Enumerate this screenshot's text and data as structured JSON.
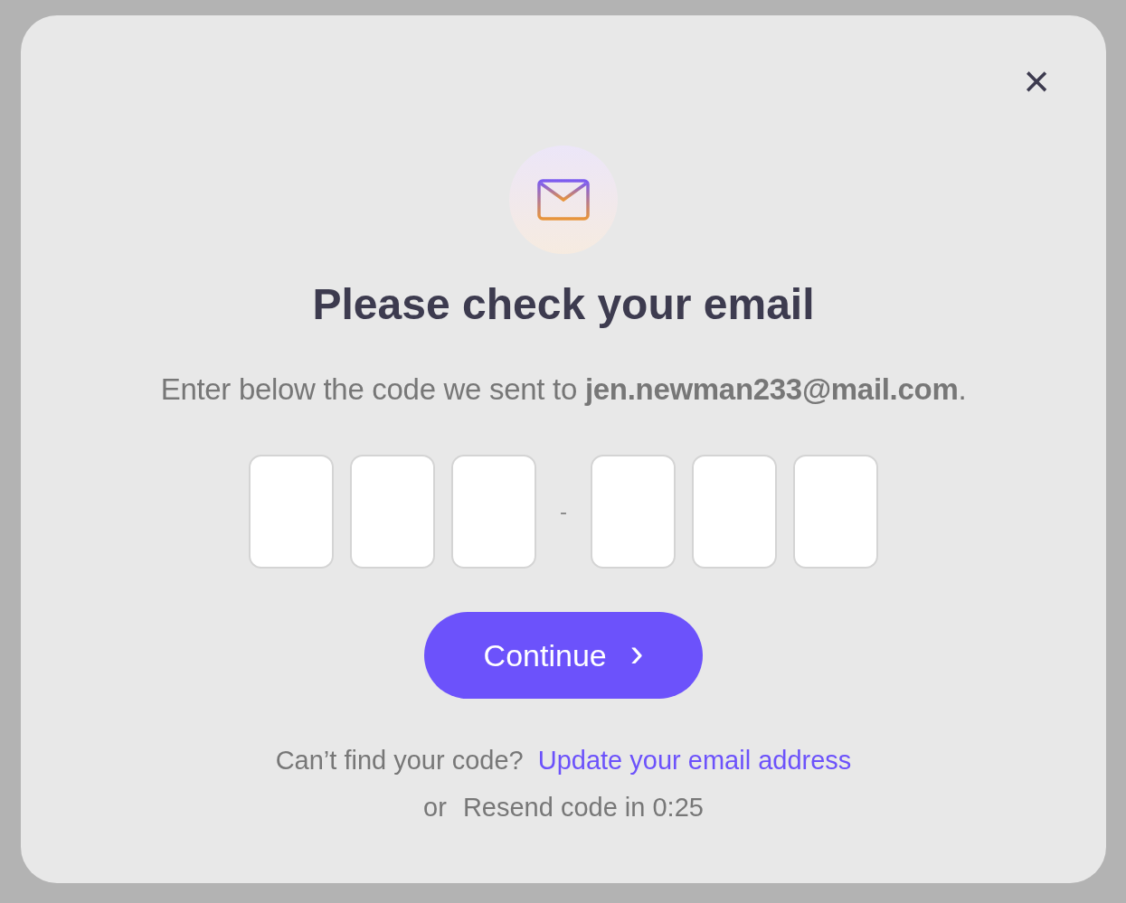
{
  "dialog": {
    "close": "×",
    "title": "Please check your email",
    "message": "Enter below the code we sent to **jen.newman233@mail.com**.",
    "code_separator": "-",
    "continue_button": {
      "label": "Continue",
      "arrow": "›"
    },
    "help": {
      "question": "Can’t find your code?",
      "link": "Update your email address",
      "or": "or",
      "resend": "Resend code in 0:25"
    }
  }
}
